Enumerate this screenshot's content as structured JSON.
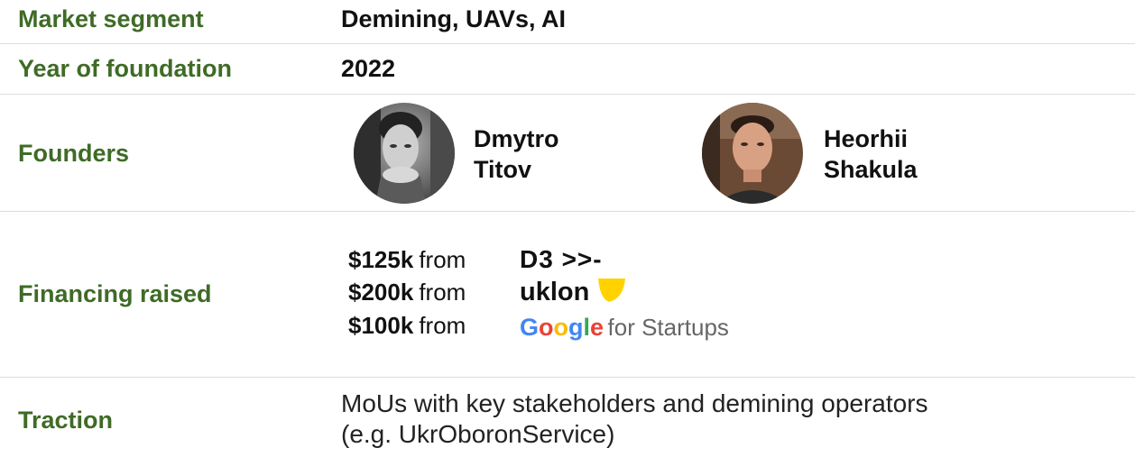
{
  "rows": {
    "market": {
      "label": "Market segment",
      "value": "Demining, UAVs, AI"
    },
    "year": {
      "label": "Year of foundation",
      "value": "2022"
    },
    "founders": {
      "label": "Founders",
      "people": [
        {
          "first": "Dmytro",
          "last": "Titov"
        },
        {
          "first": "Heorhii",
          "last": "Shakula"
        }
      ]
    },
    "financing": {
      "label": "Financing raised",
      "items": [
        {
          "amount": "$125k",
          "from": "from",
          "investor": "D3 >>-"
        },
        {
          "amount": "$200k",
          "from": "from",
          "investor": "uklon"
        },
        {
          "amount": "$100k",
          "from": "from",
          "investor_google": "Google",
          "investor_rest": "for Startups"
        }
      ]
    },
    "traction": {
      "label": "Traction",
      "line1": "MoUs with key stakeholders and demining operators",
      "line2": "(e.g. UkrOboronService)"
    }
  },
  "colors": {
    "label_green": "#3f6b26",
    "uklon_yellow": "#ffd200",
    "google_blue": "#4285f4",
    "google_red": "#ea4335",
    "google_yellow": "#fbbc05",
    "google_green": "#34a853"
  }
}
